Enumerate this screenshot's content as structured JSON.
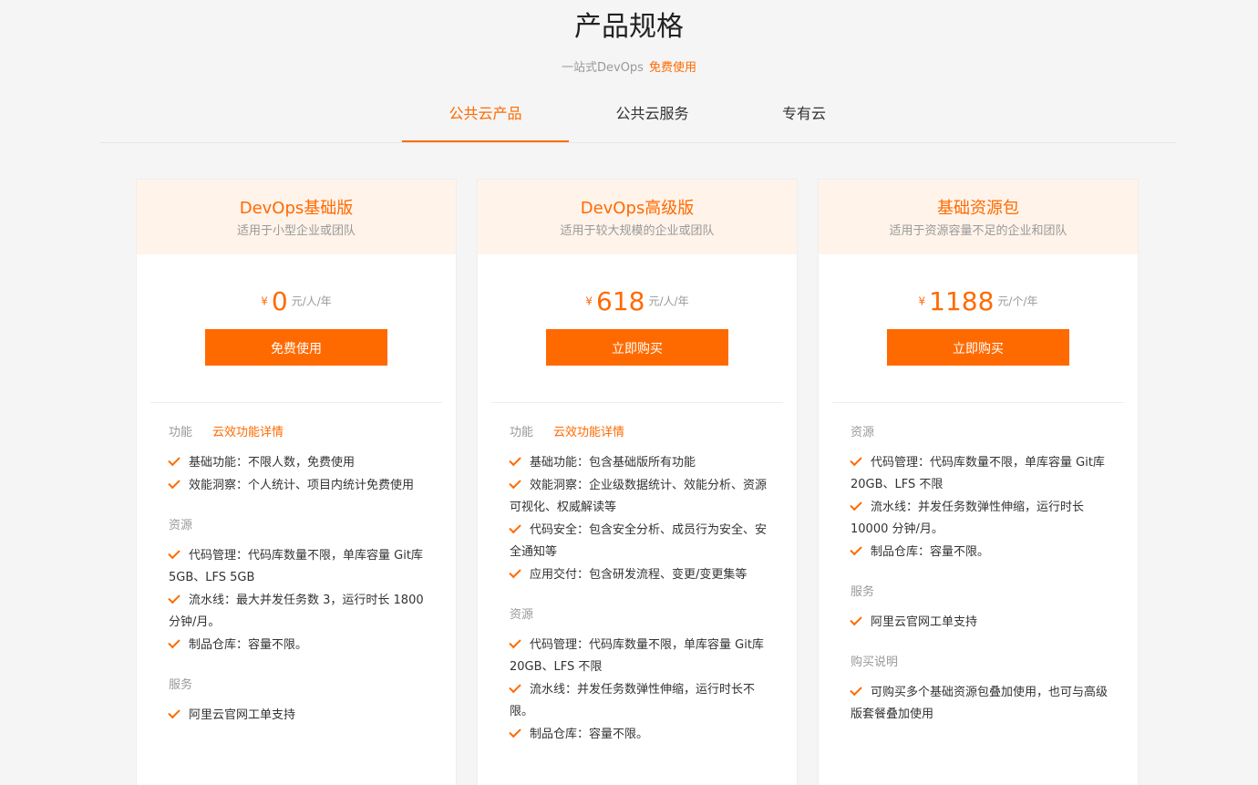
{
  "page_title": "产品规格",
  "subtitle": {
    "text": "一站式DevOps",
    "accent": "免费使用"
  },
  "tabs": [
    {
      "label": "公共云产品",
      "active": true
    },
    {
      "label": "公共云服务",
      "active": false
    },
    {
      "label": "专有云",
      "active": false
    }
  ],
  "colors": {
    "accent": "#ff6a00",
    "head_bg": "#fff3ea"
  },
  "icons": {
    "feature_check": "check-icon"
  },
  "cards": [
    {
      "name": "DevOps基础版",
      "desc": "适用于小型企业或团队",
      "currency": "¥",
      "price": "0",
      "unit": "元/人/年",
      "button": "免费使用",
      "sections": [
        {
          "label": "功能",
          "link": "云效功能详情",
          "items": [
            "基础功能：不限人数，免费使用",
            "效能洞察：个人统计、项目内统计免费使用"
          ]
        },
        {
          "label": "资源",
          "items": [
            "代码管理：代码库数量不限，单库容量 Git库5GB、LFS 5GB",
            "流水线：最大并发任务数 3，运行时长 1800 分钟/月。",
            "制品仓库：容量不限。"
          ]
        },
        {
          "label": "服务",
          "items": [
            "阿里云官网工单支持"
          ]
        }
      ]
    },
    {
      "name": "DevOps高级版",
      "desc": "适用于较大规模的企业或团队",
      "currency": "¥",
      "price": "618",
      "unit": "元/人/年",
      "button": "立即购买",
      "sections": [
        {
          "label": "功能",
          "link": "云效功能详情",
          "items": [
            "基础功能：包含基础版所有功能",
            "效能洞察：企业级数据统计、效能分析、资源可视化、权威解读等",
            "代码安全：包含安全分析、成员行为安全、安全通知等",
            "应用交付：包含研发流程、变更/变更集等"
          ]
        },
        {
          "label": "资源",
          "items": [
            "代码管理：代码库数量不限，单库容量 Git库20GB、LFS 不限",
            "流水线：并发任务数弹性伸缩，运行时长不限。",
            "制品仓库：容量不限。"
          ]
        }
      ]
    },
    {
      "name": "基础资源包",
      "desc": "适用于资源容量不足的企业和团队",
      "currency": "¥",
      "price": "1188",
      "unit": "元/个/年",
      "button": "立即购买",
      "sections": [
        {
          "label": "资源",
          "items": [
            "代码管理：代码库数量不限，单库容量 Git库20GB、LFS 不限",
            "流水线：并发任务数弹性伸缩，运行时长 10000 分钟/月。",
            "制品仓库：容量不限。"
          ]
        },
        {
          "label": "服务",
          "items": [
            "阿里云官网工单支持"
          ]
        },
        {
          "label": "购买说明",
          "items": [
            "可购买多个基础资源包叠加使用，也可与高级版套餐叠加使用"
          ]
        }
      ]
    }
  ]
}
